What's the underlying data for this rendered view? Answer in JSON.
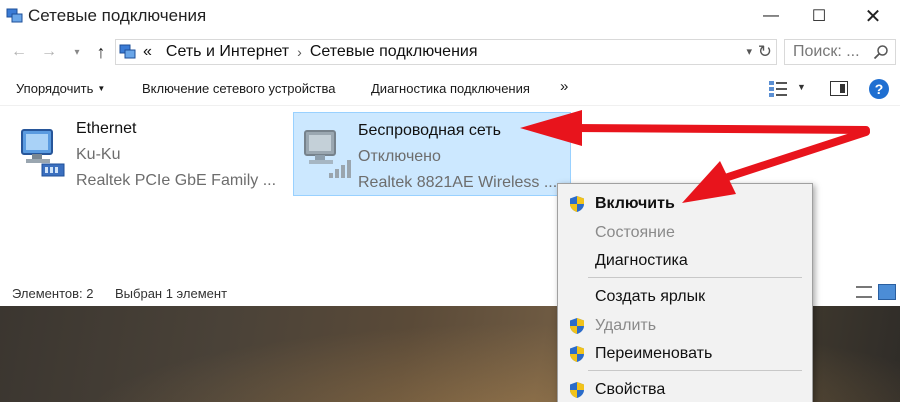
{
  "window": {
    "title": "Сетевые подключения",
    "controls": {
      "minimize": "—",
      "maximize": "☐",
      "close": "✕"
    }
  },
  "address_bar": {
    "prefix": "«",
    "breadcrumbs": [
      "Сеть и Интернет",
      "Сетевые подключения"
    ],
    "separator": "›",
    "search_placeholder": "Поиск: ..."
  },
  "command_bar": {
    "organize": "Упорядочить",
    "enable_device": "Включение сетевого устройства",
    "diagnose": "Диагностика подключения",
    "more": "»"
  },
  "connections": [
    {
      "name": "Ethernet",
      "network": "Ku-Ku",
      "adapter": "Realtek PCIe GbE Family ...",
      "selected": false
    },
    {
      "name": "Беспроводная сеть",
      "network": "Отключено",
      "adapter": "Realtek 8821AE Wireless ...",
      "selected": true
    }
  ],
  "status_bar": {
    "count": "Элементов: 2",
    "selection": "Выбран 1 элемент"
  },
  "context_menu": {
    "items": [
      {
        "label": "Включить",
        "shield": true,
        "bold": true,
        "disabled": false
      },
      {
        "label": "Состояние",
        "shield": false,
        "bold": false,
        "disabled": true
      },
      {
        "label": "Диагностика",
        "shield": false,
        "bold": false,
        "disabled": false
      },
      {
        "label": "Создать ярлык",
        "shield": false,
        "bold": false,
        "disabled": false
      },
      {
        "label": "Удалить",
        "shield": true,
        "bold": false,
        "disabled": true
      },
      {
        "label": "Переименовать",
        "shield": true,
        "bold": false,
        "disabled": false
      },
      {
        "label": "Свойства",
        "shield": true,
        "bold": false,
        "disabled": false
      }
    ]
  },
  "colors": {
    "selection_bg": "#cce8ff",
    "selection_border": "#99d1ff",
    "annotation_arrow": "#e8141c",
    "help_blue": "#1f6fd1"
  }
}
